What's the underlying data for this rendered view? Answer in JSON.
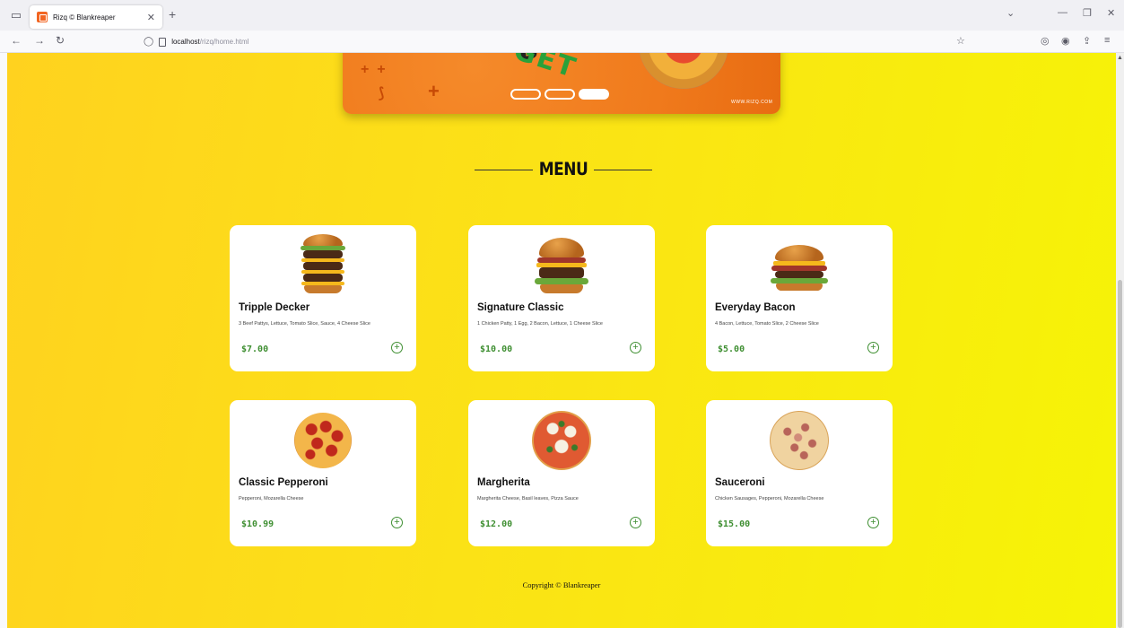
{
  "browser": {
    "tab_title": "Rizq © Blankreaper",
    "url_host": "localhost",
    "url_path": "/rizq/home.html"
  },
  "banner": {
    "url_text": "WWW.RIZQ.COM",
    "slides": [
      false,
      false,
      true
    ]
  },
  "menu": {
    "title": "MENU",
    "items": [
      {
        "name": "Tripple Decker",
        "desc": "3 Beef Pattys, Lettuce, Tomato Slice, Sauce, 4 Cheese Slice",
        "price": "$7.00",
        "kind": "burger"
      },
      {
        "name": "Signature Classic",
        "desc": "1 Chicken Patty, 1 Egg, 2 Bacon, Lettuce, 1 Cheese Slice",
        "price": "$10.00",
        "kind": "burger"
      },
      {
        "name": "Everyday Bacon",
        "desc": "4 Bacon, Lettuce, Tomato Slice, 2 Cheese Slice",
        "price": "$5.00",
        "kind": "burger"
      },
      {
        "name": "Classic Pepperoni",
        "desc": "Pepperoni, Mozarella Cheese",
        "price": "$10.99",
        "kind": "pizza"
      },
      {
        "name": "Margherita",
        "desc": "Margherita Cheese, Basil leaves, Pizza Sauce",
        "price": "$12.00",
        "kind": "pizza"
      },
      {
        "name": "Sauceroni",
        "desc": "Chicken Sausages, Pepperoni, Mozarella Cheese",
        "price": "$15.00",
        "kind": "pizza"
      }
    ]
  },
  "footer": {
    "copyright": "Copyright © Blankreaper"
  },
  "colors": {
    "accent_green": "#3f8f32",
    "background_yellow": "#fbe216",
    "banner_orange": "#f07a1c"
  }
}
